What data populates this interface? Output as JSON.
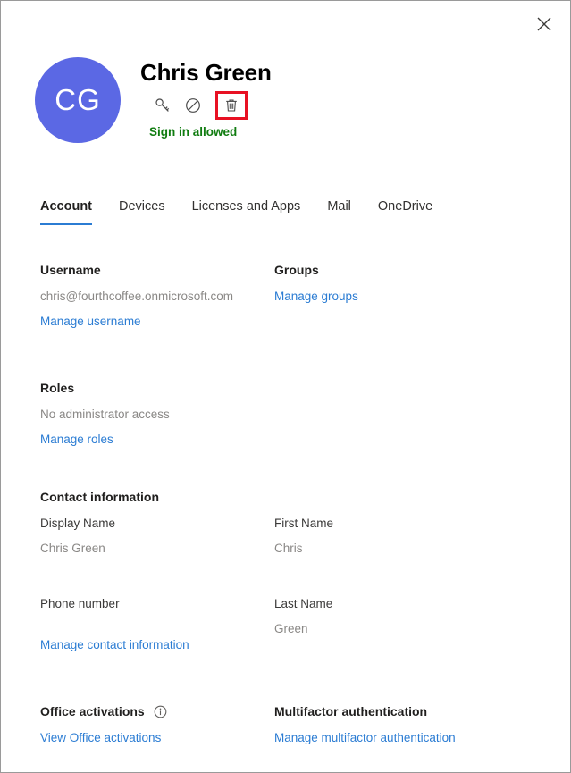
{
  "window": {
    "close_label": "Close",
    "close_icon": "close-icon"
  },
  "header": {
    "avatar_initials": "CG",
    "avatar_color": "#5b68e4",
    "user_name": "Chris Green",
    "signin_status": "Sign in allowed",
    "signin_status_color": "#107c10",
    "highlight_color": "#e81123",
    "actions": [
      {
        "name": "reset-password-icon",
        "icon": "key-icon",
        "highlighted": false
      },
      {
        "name": "block-signin-icon",
        "icon": "block-icon",
        "highlighted": false
      },
      {
        "name": "delete-user-icon",
        "icon": "trash-icon",
        "highlighted": true
      }
    ]
  },
  "tabs": {
    "active_color": "#2b7cd3",
    "items": [
      {
        "label": "Account",
        "active": true
      },
      {
        "label": "Devices",
        "active": false
      },
      {
        "label": "Licenses and Apps",
        "active": false
      },
      {
        "label": "Mail",
        "active": false
      },
      {
        "label": "OneDrive",
        "active": false
      }
    ]
  },
  "account": {
    "username": {
      "title": "Username",
      "value": "chris@fourthcoffee.onmicrosoft.com",
      "link": "Manage username"
    },
    "groups": {
      "title": "Groups",
      "link": "Manage groups"
    },
    "roles": {
      "title": "Roles",
      "value": "No administrator access",
      "link": "Manage roles"
    },
    "contact": {
      "title": "Contact information",
      "display_name_label": "Display Name",
      "display_name_value": "Chris Green",
      "first_name_label": "First Name",
      "first_name_value": "Chris",
      "phone_label": "Phone number",
      "phone_value": "",
      "last_name_label": "Last Name",
      "last_name_value": "Green",
      "link": "Manage contact information"
    },
    "office_activations": {
      "title": "Office activations",
      "info_icon": "info-icon",
      "link": "View Office activations"
    },
    "mfa": {
      "title": "Multifactor authentication",
      "link": "Manage multifactor authentication"
    }
  },
  "link_color": "#2b7cd3"
}
